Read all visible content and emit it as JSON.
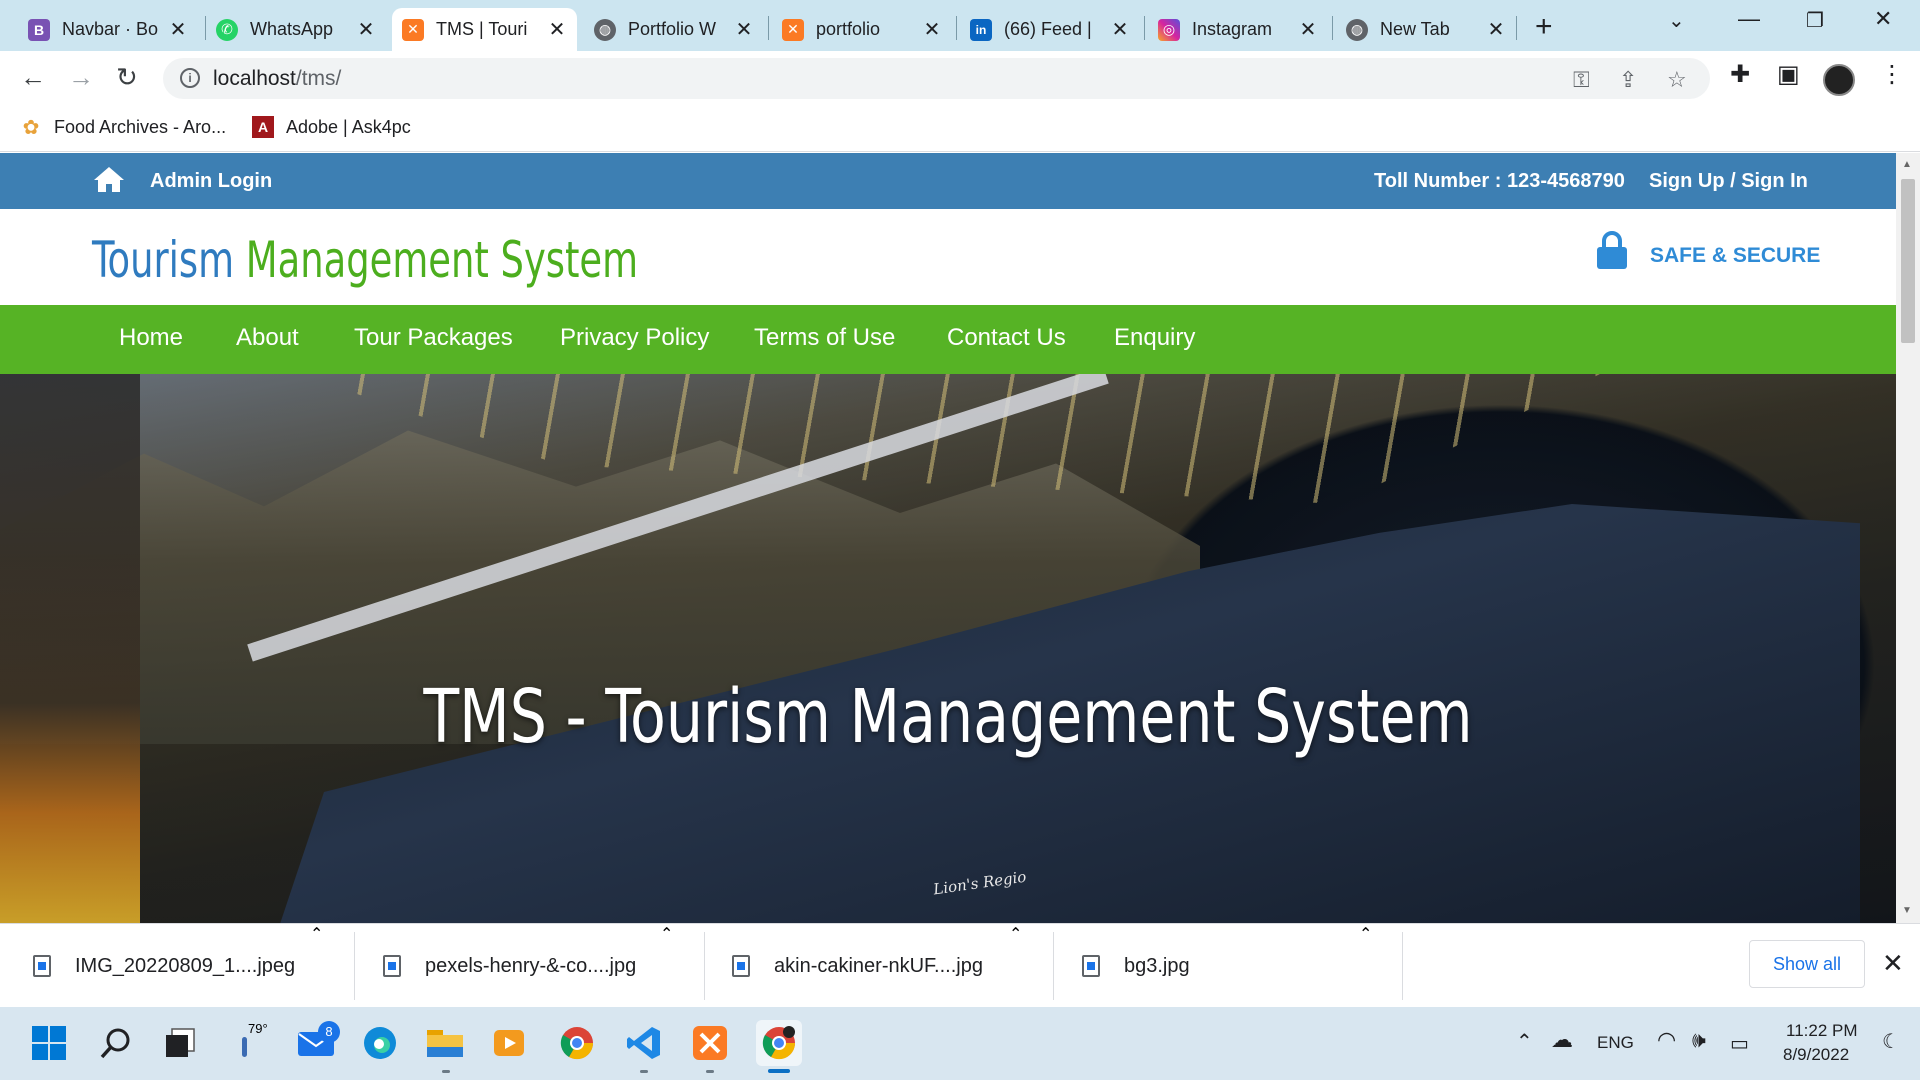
{
  "browser": {
    "tabs": [
      {
        "label": "Navbar · Bo",
        "color": "#7952b3",
        "glyph": "B"
      },
      {
        "label": "WhatsApp",
        "color": "#25d366",
        "glyph": "✆"
      },
      {
        "label": "TMS | Touri",
        "color": "#fb7a24",
        "glyph": "✕",
        "active": true
      },
      {
        "label": "Portfolio W",
        "color": "#5f6368",
        "glyph": "◍"
      },
      {
        "label": "portfolio",
        "color": "#fb7a24",
        "glyph": "✕"
      },
      {
        "label": "(66) Feed | ",
        "color": "#0a66c2",
        "glyph": "in"
      },
      {
        "label": "Instagram",
        "color": "#d6249f",
        "glyph": "◎"
      },
      {
        "label": "New Tab",
        "color": "#5f6368",
        "glyph": "◍"
      }
    ],
    "url_host": "localhost",
    "url_path": "/tms/",
    "bookmarks": [
      {
        "label": "Food Archives - Aro...",
        "color": "#e8a23a",
        "glyph": "✿"
      },
      {
        "label": "Adobe | Ask4pc",
        "color": "#a0181c",
        "glyph": "A"
      }
    ]
  },
  "site": {
    "admin_login": "Admin Login",
    "toll_number": "Toll Number : 123-4568790",
    "signin": "Sign Up / Sign In",
    "brand_part1": "Tourism",
    "brand_part2": "Management System",
    "secure": "SAFE & SECURE",
    "nav": [
      "Home",
      "About",
      "Tour Packages",
      "Privacy Policy",
      "Terms of Use",
      "Contact Us",
      "Enquiry"
    ],
    "hero_title": "TMS - Tourism Management System",
    "hero_bus_name": "Lion's Regio",
    "colors": {
      "topbar": "#3d7fb3",
      "brand_blue": "#2f7bbf",
      "brand_green": "#4cae1e",
      "nav_green": "#56b325"
    }
  },
  "downloads": {
    "files": [
      "IMG_20220809_1....jpeg",
      "pexels-henry-&-co....jpg",
      "akin-cakiner-nkUF....jpg",
      "bg3.jpg"
    ],
    "show_all": "Show all"
  },
  "taskbar": {
    "weather_temp": "79°",
    "mail_badge": "8",
    "language": "ENG",
    "time": "11:22 PM",
    "date": "8/9/2022"
  }
}
